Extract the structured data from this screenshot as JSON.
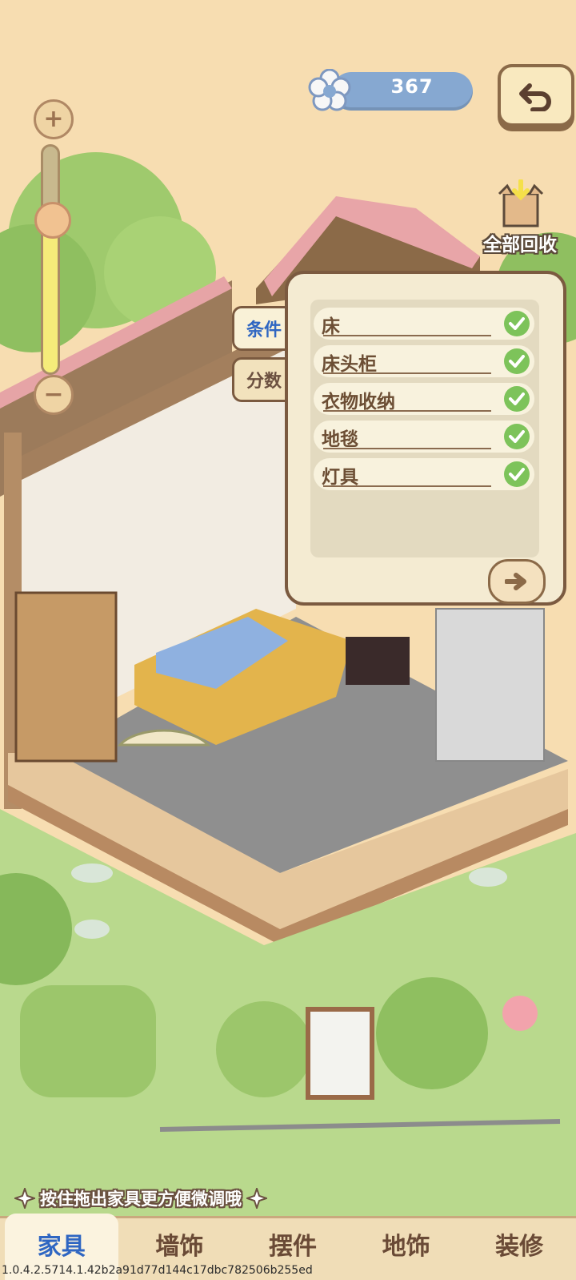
{
  "currency": {
    "value": "367",
    "icon": "flower-icon"
  },
  "recycle": {
    "label": "全部回收",
    "icon": "box-icon"
  },
  "side_tabs": [
    {
      "label": "条件",
      "active": true
    },
    {
      "label": "分数",
      "active": false
    }
  ],
  "conditions": [
    {
      "label": "床",
      "met": true
    },
    {
      "label": "床头柜",
      "met": true
    },
    {
      "label": "衣物收纳",
      "met": true
    },
    {
      "label": "地毯",
      "met": true
    },
    {
      "label": "灯具",
      "met": true
    }
  ],
  "hint": "按住拖出家具更方便微调哦",
  "bottom_tabs": [
    {
      "label": "家具",
      "active": true
    },
    {
      "label": "墙饰",
      "active": false
    },
    {
      "label": "摆件",
      "active": false
    },
    {
      "label": "地饰",
      "active": false
    },
    {
      "label": "装修",
      "active": false
    }
  ],
  "version": "1.0.4.2.5714.1.42b2a91d77d144c17dbc782506b255ed",
  "colors": {
    "accent": "#2f66c2",
    "check": "#7dc35a",
    "frame": "#7b5a40",
    "currency_bar": "#86a8d1"
  }
}
